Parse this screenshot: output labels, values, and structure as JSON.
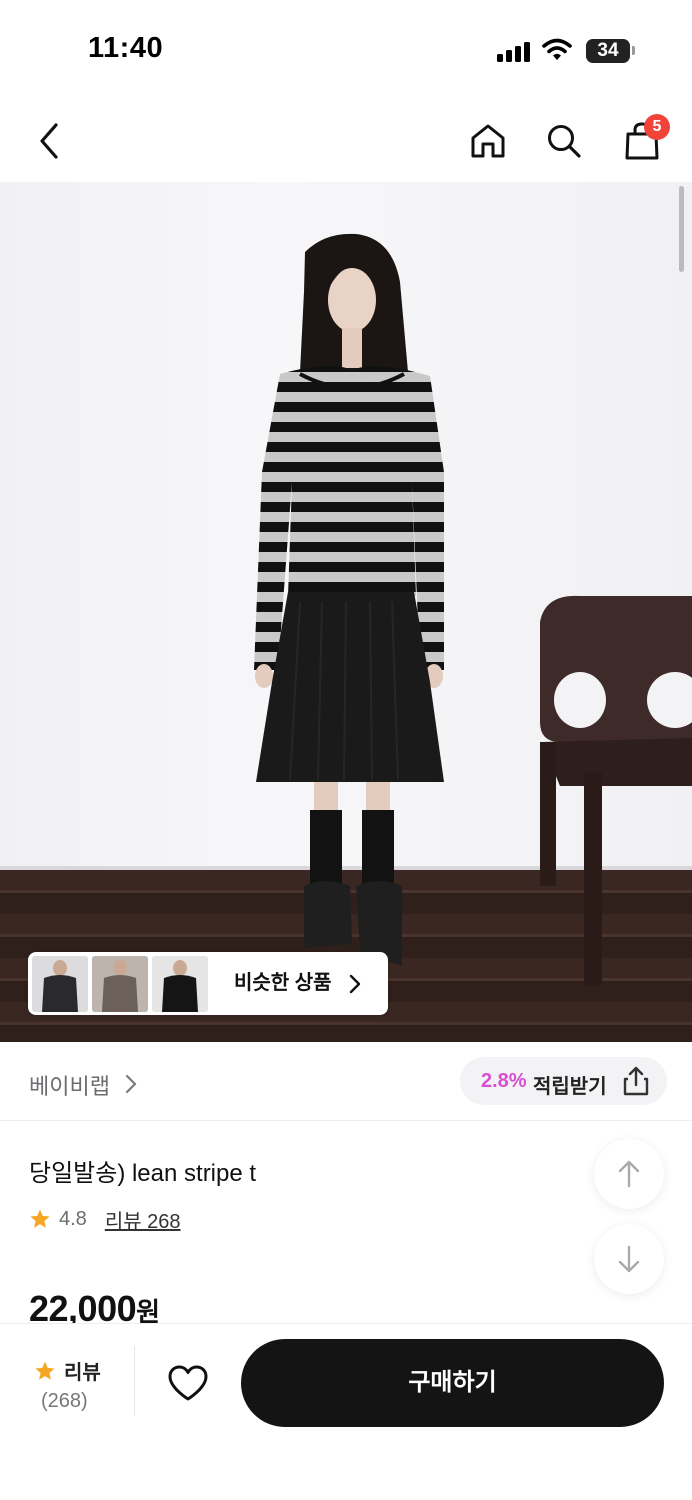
{
  "status_bar": {
    "time": "11:40",
    "battery": "34"
  },
  "nav": {
    "back_icon": "chevron-left-icon",
    "home_icon": "home-icon",
    "search_icon": "search-icon",
    "cart_icon": "shopping-bag-icon",
    "cart_count": "5"
  },
  "hero": {
    "similar_label": "비슷한 상품"
  },
  "brand": {
    "name": "베이비랩",
    "points_percent": "2.8%",
    "points_label": "적립받기"
  },
  "product": {
    "title": "당일발송) lean stripe t",
    "rating": "4.8",
    "review_link": "리뷰 268",
    "price": "22,000",
    "price_unit": "원"
  },
  "bottom_bar": {
    "review_label": "리뷰",
    "review_count": "(268)",
    "buy_label": "구매하기"
  },
  "colors": {
    "accent_points": "#d94fd3",
    "badge": "#f0443a",
    "star": "#f5a623",
    "buy_button": "#141414"
  }
}
